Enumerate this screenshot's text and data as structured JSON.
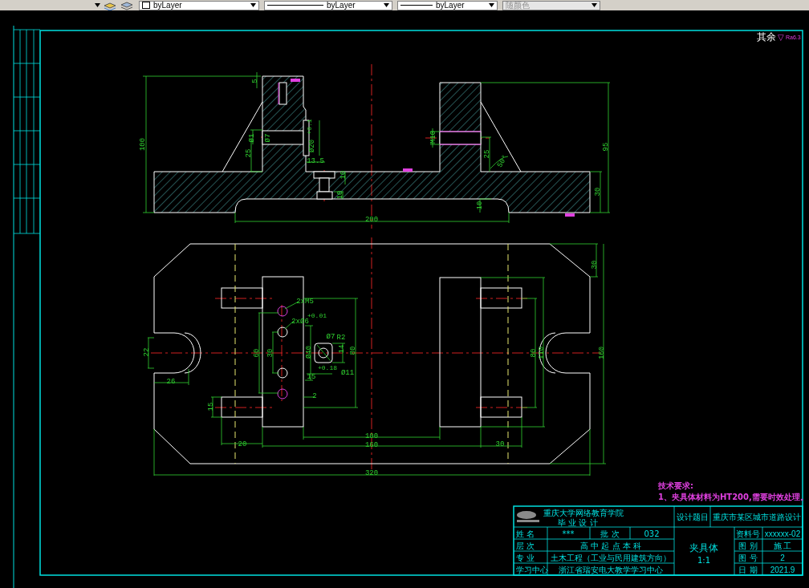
{
  "toolbar": {
    "controls": [
      {
        "kind": "color",
        "value": "byLayer",
        "disabled": false
      },
      {
        "kind": "linetype",
        "value": "byLayer",
        "disabled": false
      },
      {
        "kind": "lineweight",
        "value": "byLayer",
        "disabled": false
      },
      {
        "kind": "plotstyle",
        "value": "随颜色",
        "disabled": true
      }
    ]
  },
  "drawing": {
    "roughness_note": {
      "label": "其余",
      "symbol": "▽",
      "value": "Ra6.3"
    },
    "front_view_dimensions": [
      {
        "text": "5"
      },
      {
        "text": "100"
      },
      {
        "text": "Ø1"
      },
      {
        "text": "Ø7"
      },
      {
        "text": "25"
      },
      {
        "text": "Ø20"
      },
      {
        "text": "+0.1"
      },
      {
        "text": "13.5"
      },
      {
        "text": "10"
      },
      {
        "text": "10"
      },
      {
        "text": "200"
      },
      {
        "text": "M10"
      },
      {
        "text": "25"
      },
      {
        "text": "50°"
      },
      {
        "text": "10"
      },
      {
        "text": "95"
      },
      {
        "text": "30"
      }
    ],
    "plan_view_dimensions": [
      {
        "text": "2xM5"
      },
      {
        "text": "2xØ6"
      },
      {
        "text": "+0.01"
      },
      {
        "text": "Ø7"
      },
      {
        "text": "R2"
      },
      {
        "text": "22"
      },
      {
        "text": "26"
      },
      {
        "text": "60"
      },
      {
        "text": "30"
      },
      {
        "text": "Ø40"
      },
      {
        "text": "14"
      },
      {
        "text": "80"
      },
      {
        "text": "15"
      },
      {
        "text": "+0.18"
      },
      {
        "text": "Ø11"
      },
      {
        "text": "2"
      },
      {
        "text": "15"
      },
      {
        "text": "20"
      },
      {
        "text": "100"
      },
      {
        "text": "160"
      },
      {
        "text": "30"
      },
      {
        "text": "30"
      },
      {
        "text": "80"
      },
      {
        "text": "110"
      },
      {
        "text": "160"
      },
      {
        "text": "320"
      }
    ],
    "technical_requirements": {
      "title": "技术要求:",
      "items": [
        "1、夹具体材料为HT200,需要时效处理。"
      ]
    },
    "title_block": {
      "school": "重庆大学网络教育学院",
      "document": "毕 业 设 计",
      "topic_label": "设计题目",
      "topic": "重庆市某区城市道路设计",
      "rows": [
        {
          "label": "姓 名",
          "value": "***",
          "label_2": "批 次",
          "value_2": "032"
        },
        {
          "label": "层 次",
          "value": "高 中 起 点 本 科"
        },
        {
          "label": "专 业",
          "value": "土木工程（工业与民用建筑方向）"
        },
        {
          "label": "学习中心",
          "value": "浙江省瑞安电大教学学习中心"
        }
      ],
      "part_name": "夹具体",
      "scale": "1:1",
      "info": [
        {
          "label": "资料号",
          "value": "xxxxxx-02"
        },
        {
          "label": "图 别",
          "value": "施 工"
        },
        {
          "label": "图 号",
          "value": "2"
        },
        {
          "label": "日 期",
          "value": "2021.9"
        }
      ]
    }
  }
}
